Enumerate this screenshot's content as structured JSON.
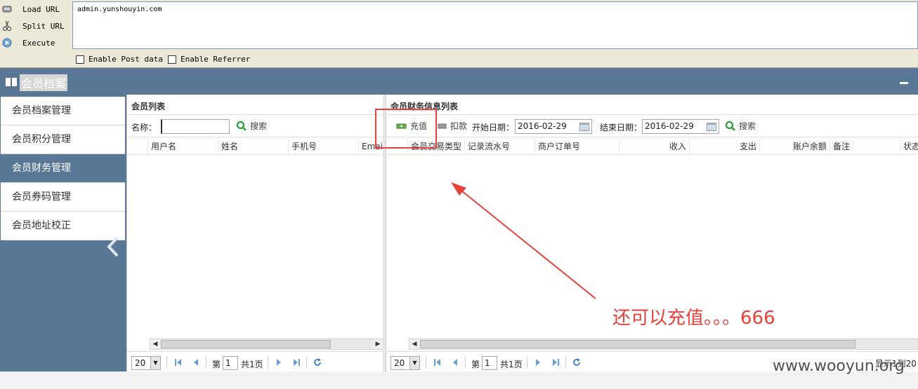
{
  "hackbar": {
    "load_url": "Load URL",
    "split_url": "Split URL",
    "execute": "Execute",
    "url_value": "admin.yunshouyin.com",
    "enable_post": "Enable Post data",
    "enable_referrer": "Enable Referrer"
  },
  "header": {
    "title": "会员档案"
  },
  "sidebar": {
    "items": [
      {
        "label": "会员档案管理"
      },
      {
        "label": "会员积分管理"
      },
      {
        "label": "会员财务管理"
      },
      {
        "label": "会员券码管理"
      },
      {
        "label": "会员地址校正"
      }
    ]
  },
  "left_panel": {
    "title": "会员列表",
    "name_label": "名称：",
    "name_value": "",
    "search": "搜索",
    "columns": [
      "用户名",
      "姓名",
      "手机号",
      "Email"
    ],
    "page_size": "20",
    "page_prefix": "第",
    "page_num": "1",
    "page_total": "共1页"
  },
  "right_panel": {
    "title": "会员财务信息列表",
    "recharge": "充值",
    "deduct": "扣款",
    "start_label": "开始日期：",
    "start_date": "2016-02-29",
    "end_label": "结束日期：",
    "end_date": "2016-02-29",
    "search": "搜索",
    "columns": [
      "会员交易类型",
      "记录流水号",
      "商户订单号",
      "收入",
      "支出",
      "账户余额",
      "备注",
      "状态"
    ],
    "page_size": "20",
    "page_prefix": "第",
    "page_num": "1",
    "page_total": "共1页",
    "display_text": "显示1到20"
  },
  "annotation": {
    "text": "还可以充值。。。666"
  },
  "watermark": "www.wooyun.org"
}
